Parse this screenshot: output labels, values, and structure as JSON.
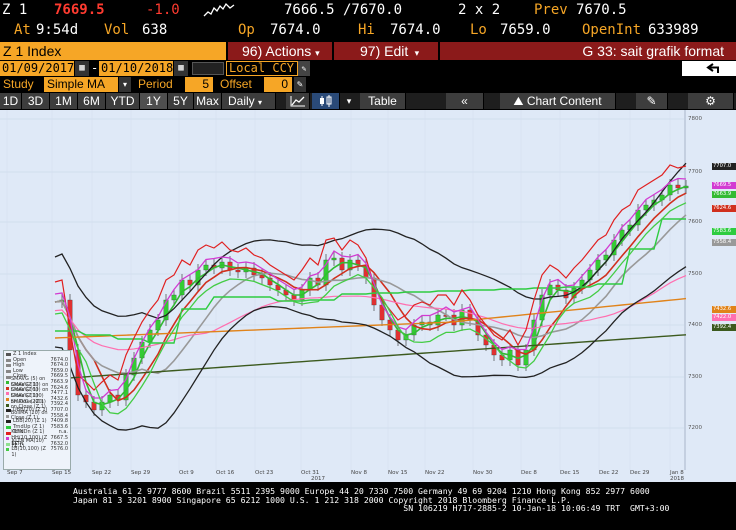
{
  "quote": {
    "ticker": "Z 1",
    "last": "7669.5",
    "change": "-1.0",
    "bid_ask": "7666.5 /7670.0",
    "size": "2 x 2",
    "prev_label": "Prev",
    "prev": "7670.5",
    "at_label": "At",
    "time": "9:54d",
    "vol_label": "Vol",
    "vol": "638",
    "op_label": "Op",
    "open": "7674.0",
    "hi_label": "Hi",
    "high": "7674.0",
    "lo_label": "Lo",
    "low": "7659.0",
    "oi_label": "OpenInt",
    "open_interest": "633989"
  },
  "toolbar": {
    "security": "Z 1 Index",
    "actions": "96) Actions",
    "edit": "97) Edit",
    "function_title": "G 33: sait grafik format"
  },
  "date_range": {
    "start": "01/09/2017",
    "end": "01/10/2018",
    "currency": "Local CCY"
  },
  "study": {
    "label": "Study",
    "type": "Simple MA",
    "period_label": "Period",
    "period": "5",
    "offset_label": "Offset",
    "offset": "0"
  },
  "range_tabs": [
    "1D",
    "3D",
    "1M",
    "6M",
    "YTD",
    "1Y",
    "5Y",
    "Max"
  ],
  "selected_range": "1Y",
  "interval": "Daily",
  "buttons": {
    "table": "Table",
    "chart_content": "Chart Content"
  },
  "colors": {
    "amber": "#f6a626",
    "header_bg": "#000000",
    "red_bar": "#8b1a1a",
    "chart_bg": "#dfe9f7",
    "candle_up": "#33cc33",
    "candle_down": "#e03030"
  },
  "y_axis_ticks": [
    "7800",
    "7700",
    "7600",
    "7500",
    "7400",
    "7300",
    "7200"
  ],
  "x_axis_ticks": [
    "Sep 7",
    "Sep 15",
    "Sep 22",
    "Sep 29",
    "Oct 9",
    "Oct 16",
    "Oct 23",
    "Oct 31",
    "Nov 8",
    "Nov 15",
    "Nov 22",
    "Nov 30",
    "Dec 8",
    "Dec 15",
    "Dec 22",
    "Dec 29",
    "Jan 8"
  ],
  "x_axis_year_2017": "2017",
  "x_axis_year_2018": "2018",
  "price_tags": [
    {
      "value": "7707.0",
      "color": "#222222"
    },
    {
      "value": "7669.5",
      "color": "#d23bd2"
    },
    {
      "value": "7663.9",
      "color": "#33bb33"
    },
    {
      "value": "7624.6",
      "color": "#d0301e"
    },
    {
      "value": "7583.6",
      "color": "#2ecc40"
    },
    {
      "value": "7558.4",
      "color": "#999999"
    },
    {
      "value": "7432.6",
      "color": "#e0831a"
    },
    {
      "value": "7422.0",
      "color": "#ff6fb0"
    },
    {
      "value": "7392.4",
      "color": "#3c5a1e"
    }
  ],
  "legend": [
    {
      "label": "Z 1 Index",
      "value": "",
      "color": "#555555"
    },
    {
      "label": "Open",
      "value": "7674.0",
      "color": "#888888"
    },
    {
      "label": "High",
      "value": "7674.0",
      "color": "#888888"
    },
    {
      "label": "Low",
      "value": "7659.0",
      "color": "#888888"
    },
    {
      "label": "Close",
      "value": "7669.5",
      "color": "#888888"
    },
    {
      "label": "SMAVG (5) on Close (Z 1)",
      "value": "7663.9",
      "color": "#33bb33"
    },
    {
      "label": "SMAVG (10) on Close (Z 1)",
      "value": "7624.6",
      "color": "#d0301e"
    },
    {
      "label": "SMAVG (60) on Close (Z 1)",
      "value": "7477.1",
      "color": "#ff6fb0"
    },
    {
      "label": "SMAVG (100) on Close (Z 1)",
      "value": "7432.6",
      "color": "#e0831a"
    },
    {
      "label": "SMAVG (200) on Close (Z 1)",
      "value": "7392.4",
      "color": "#3c5a1e"
    },
    {
      "label": "UBB(20) (Z 1)",
      "value": "7707.0",
      "color": "#222222"
    },
    {
      "label": "BollMA (20) on Close (Z 1)",
      "value": "7558.4",
      "color": "#999999"
    },
    {
      "label": "LBB(20) (Z 1)",
      "value": "7409.8",
      "color": "#222222"
    },
    {
      "label": "TrndUp (Z 1)",
      "value": "7583.6",
      "color": "#2ecc40"
    },
    {
      "label": "TrndDn (Z 1)",
      "value": "n.a.",
      "color": "#e02020"
    },
    {
      "label": "KLTN HH(10,100) (Z 1)",
      "value": "7667.5",
      "color": "#d23bd2"
    },
    {
      "label": "KLTN MA(10) (Z 1)",
      "value": "7632.0",
      "color": "#8fe08f"
    },
    {
      "label": "KLTN LB(10,100) (Z 1)",
      "value": "7576.0",
      "color": "#44cc44"
    }
  ],
  "ticker_lines": [
    "Australia 61 2 9777 8600 Brazil 5511 2395 9000 Europe 44 20 7330 7500 Germany 49 69 9204 1210 Hong Kong 852 2977 6000",
    "Japan 81 3 3201 8900        Singapore 65 6212 1000     U.S. 1 212 318 2000        Copyright 2018 Bloomberg Finance L.P.",
    "                                                                   SN 106219 H717-2885-2 10-Jan-18 10:06:49 TRT  GMT+3:00"
  ]
}
